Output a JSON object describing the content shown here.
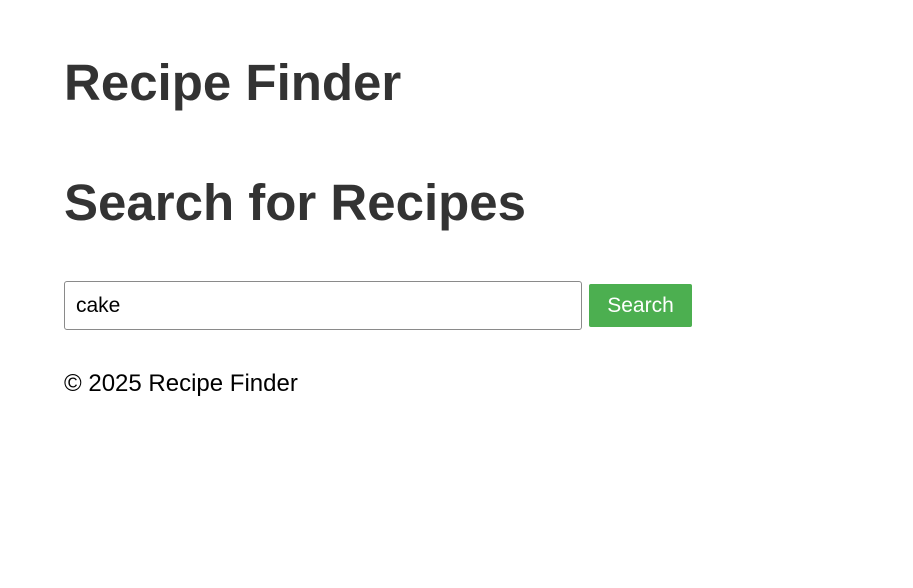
{
  "header": {
    "title": "Recipe Finder"
  },
  "search": {
    "heading": "Search for Recipes",
    "value": "cake",
    "button_label": "Search"
  },
  "footer": {
    "text": "© 2025 Recipe Finder"
  },
  "colors": {
    "heading_text": "#333333",
    "button_bg": "#4caf50",
    "button_text": "#ffffff"
  }
}
